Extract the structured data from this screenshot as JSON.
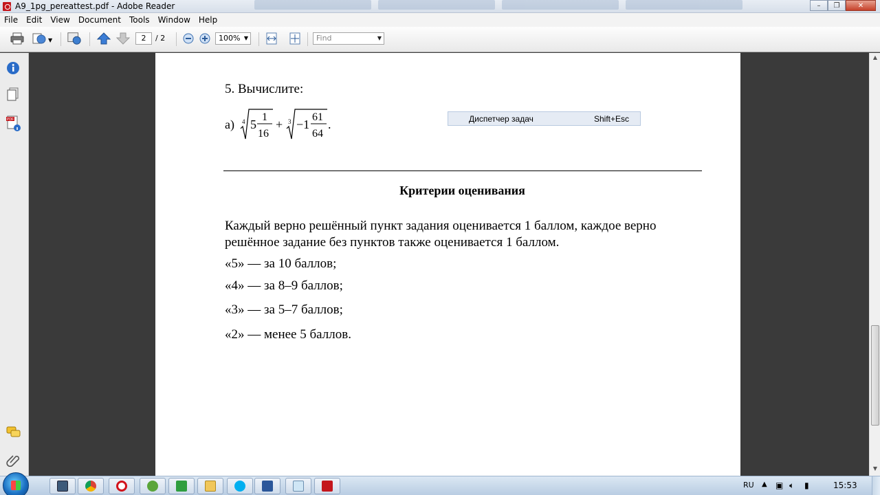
{
  "window": {
    "title": "A9_1pg_pereattest.pdf - Adobe Reader"
  },
  "menu": {
    "items": [
      "File",
      "Edit",
      "View",
      "Document",
      "Tools",
      "Window",
      "Help"
    ]
  },
  "toolbar": {
    "page_current": "2",
    "page_total": "/ 2",
    "zoom": "100%",
    "find_placeholder": "Find"
  },
  "document": {
    "question": "5. Вычислите:",
    "formula": {
      "label": "а)",
      "root1_index": "4",
      "root1_whole": "5",
      "root1_num": "1",
      "root1_den": "16",
      "plus": "+",
      "root2_index": "3",
      "root2_whole": "−1",
      "root2_num": "61",
      "root2_den": "64",
      "end": "."
    },
    "criteria_title": "Критерии оценивания",
    "criteria_text": "Каждый верно решённый пункт задания оценивается 1 баллом, каждое верно решённое задание без пунктов также оценивается 1 баллом.",
    "grades": [
      "«5» — за 10 баллов;",
      "«4» — за 8–9 баллов;",
      "«3» — за 5–7 баллов;",
      "«2» — менее 5 баллов."
    ]
  },
  "context_menu": {
    "label": "Диспетчер задач",
    "shortcut": "Shift+Esc"
  },
  "taskbar": {
    "language": "RU",
    "clock": "15:53"
  },
  "colors": {
    "accent_red": "#c4161c",
    "nav_blue": "#2a6cc8"
  }
}
